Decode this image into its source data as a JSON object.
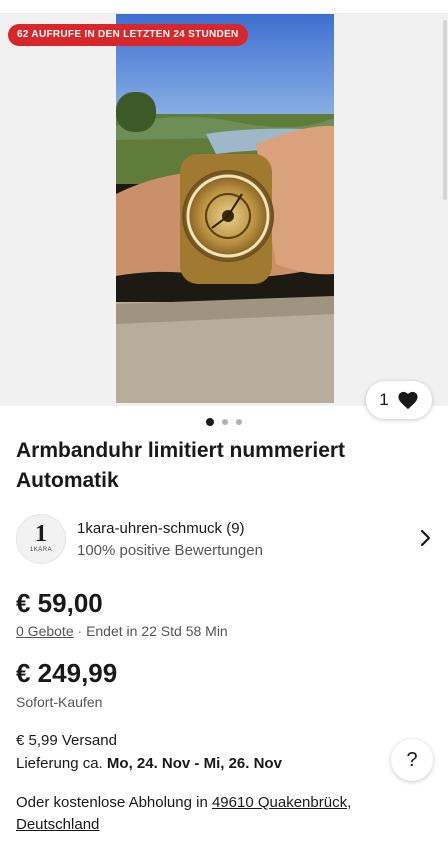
{
  "banner": {
    "views_text": "62 AUFRUFE IN DEN LETZTEN 24 STUNDEN"
  },
  "gallery": {
    "image_count": 3,
    "active_index": 0
  },
  "watchlist": {
    "count": "1",
    "icon": "heart-icon"
  },
  "listing": {
    "title": "Armbanduhr limitiert nummeriert Automatik"
  },
  "seller": {
    "logo_number": "1",
    "logo_text": "1KARA",
    "name": "1kara-uhren-schmuck (9)",
    "rating": "100% positive Bewertungen"
  },
  "auction": {
    "current_price": "€ 59,00",
    "bids": "0 Gebote",
    "separator": "·",
    "ends": "Endet in 22 Std 58 Min"
  },
  "buy_now": {
    "price": "€ 249,99",
    "label": "Sofort-Kaufen"
  },
  "shipping": {
    "cost": "€ 5,99 Versand",
    "delivery_prefix": "Lieferung ca. ",
    "delivery_dates": "Mo, 24. Nov - Mi, 26. Nov"
  },
  "pickup": {
    "prefix": "Oder kostenlose Abholung in ",
    "location": "49610 Quakenbrück",
    "comma": ",",
    "country": "Deutschland"
  },
  "help": {
    "label": "?"
  },
  "colors": {
    "badge": "#d8272a",
    "text": "#191919",
    "secondary": "#555555"
  }
}
